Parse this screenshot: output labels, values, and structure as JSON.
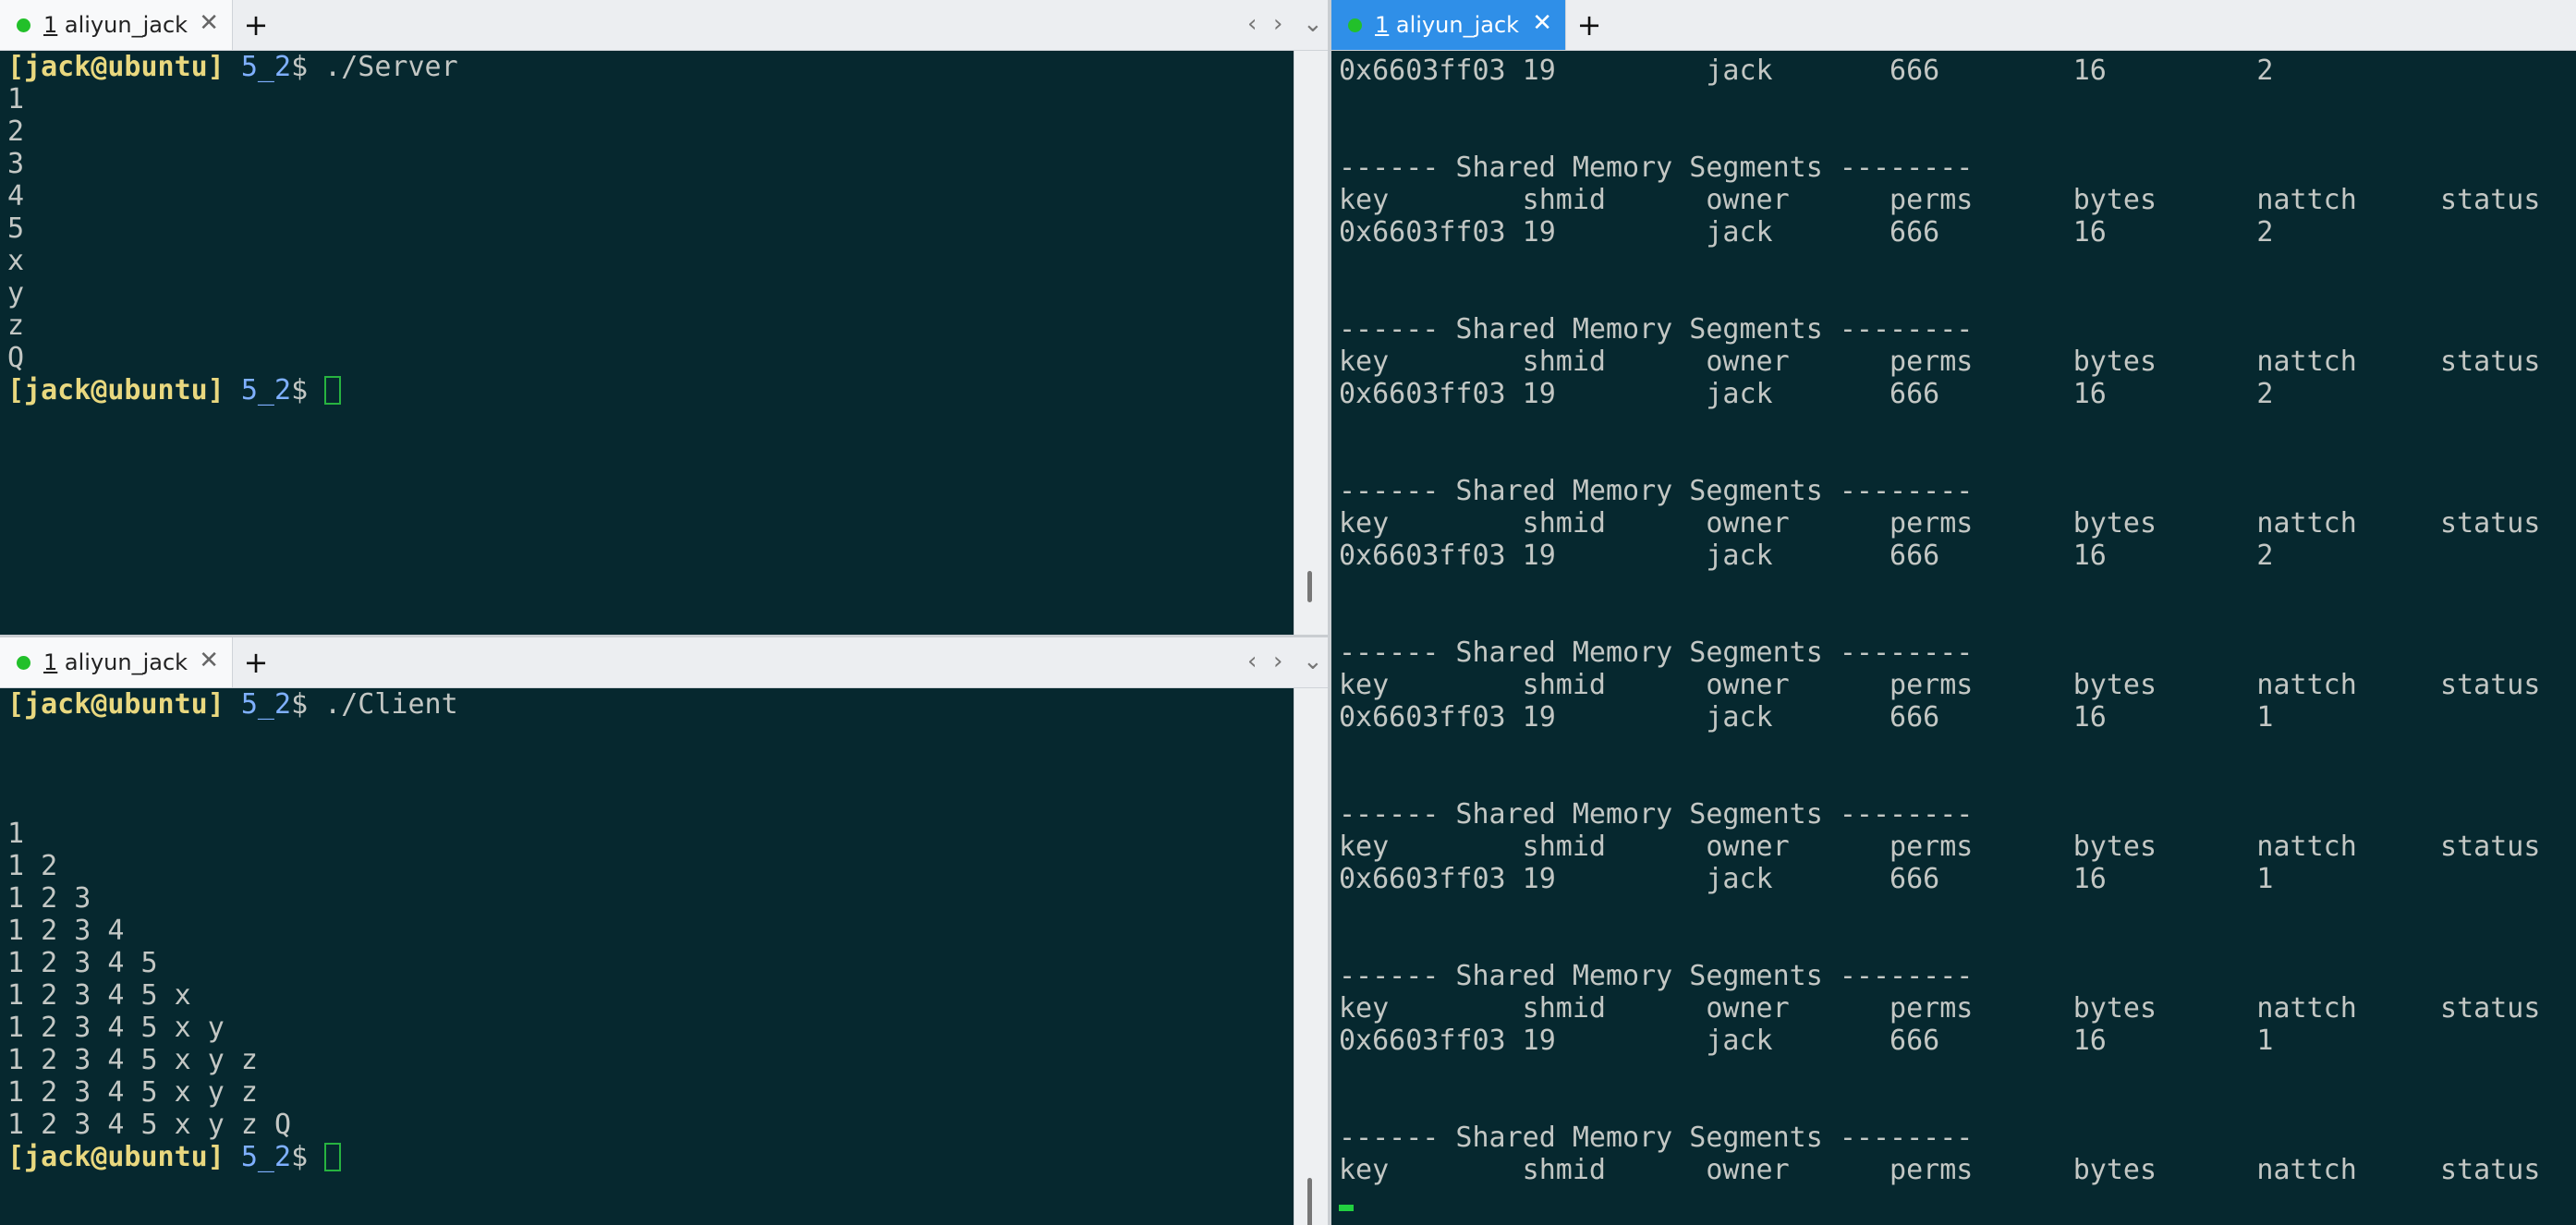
{
  "colors": {
    "terminal_bg": "#06282f",
    "prompt_user": "#e9d87f",
    "prompt_dir": "#7fb0ff",
    "active_tab": "#2f8fe8",
    "status_dot": "#22c02a"
  },
  "left_top": {
    "tab": {
      "num": "1",
      "name": " aliyun_jack",
      "close": "✕",
      "add": "+"
    },
    "nav": {
      "prev": "‹",
      "next": "›",
      "menu": "⌄"
    },
    "prompt1": {
      "user": "[jack@ubuntu]",
      "dir": " 5_2",
      "rest": "$ ./Server"
    },
    "output": [
      "1",
      "2",
      "3",
      "4",
      "5",
      "x",
      "y",
      "z",
      "Q"
    ],
    "prompt2": {
      "user": "[jack@ubuntu]",
      "dir": " 5_2",
      "rest": "$ "
    }
  },
  "left_bottom": {
    "tab": {
      "num": "1",
      "name": " aliyun_jack",
      "close": "✕",
      "add": "+"
    },
    "nav": {
      "prev": "‹",
      "next": "›",
      "menu": "⌄"
    },
    "prompt1": {
      "user": "[jack@ubuntu]",
      "dir": " 5_2",
      "rest": "$ ./Client"
    },
    "output": [
      "",
      "",
      "",
      "1",
      "1 2",
      "1 2 3",
      "1 2 3 4",
      "1 2 3 4 5",
      "1 2 3 4 5 x",
      "1 2 3 4 5 x y",
      "1 2 3 4 5 x y z",
      "1 2 3 4 5 x y z",
      "1 2 3 4 5 x y z Q"
    ],
    "prompt2": {
      "user": "[jack@ubuntu]",
      "dir": " 5_2",
      "rest": "$ "
    }
  },
  "right": {
    "tab": {
      "num": "1",
      "name": " aliyun_jack",
      "close": "✕",
      "add": "+"
    },
    "lines": [
      "0x6603ff03 19         jack       666        16         2",
      "",
      "",
      "------ Shared Memory Segments --------",
      "key        shmid      owner      perms      bytes      nattch     status",
      "0x6603ff03 19         jack       666        16         2",
      "",
      "",
      "------ Shared Memory Segments --------",
      "key        shmid      owner      perms      bytes      nattch     status",
      "0x6603ff03 19         jack       666        16         2",
      "",
      "",
      "------ Shared Memory Segments --------",
      "key        shmid      owner      perms      bytes      nattch     status",
      "0x6603ff03 19         jack       666        16         2",
      "",
      "",
      "------ Shared Memory Segments --------",
      "key        shmid      owner      perms      bytes      nattch     status",
      "0x6603ff03 19         jack       666        16         1",
      "",
      "",
      "------ Shared Memory Segments --------",
      "key        shmid      owner      perms      bytes      nattch     status",
      "0x6603ff03 19         jack       666        16         1",
      "",
      "",
      "------ Shared Memory Segments --------",
      "key        shmid      owner      perms      bytes      nattch     status",
      "0x6603ff03 19         jack       666        16         1",
      "",
      "",
      "------ Shared Memory Segments --------",
      "key        shmid      owner      perms      bytes      nattch     status"
    ]
  }
}
